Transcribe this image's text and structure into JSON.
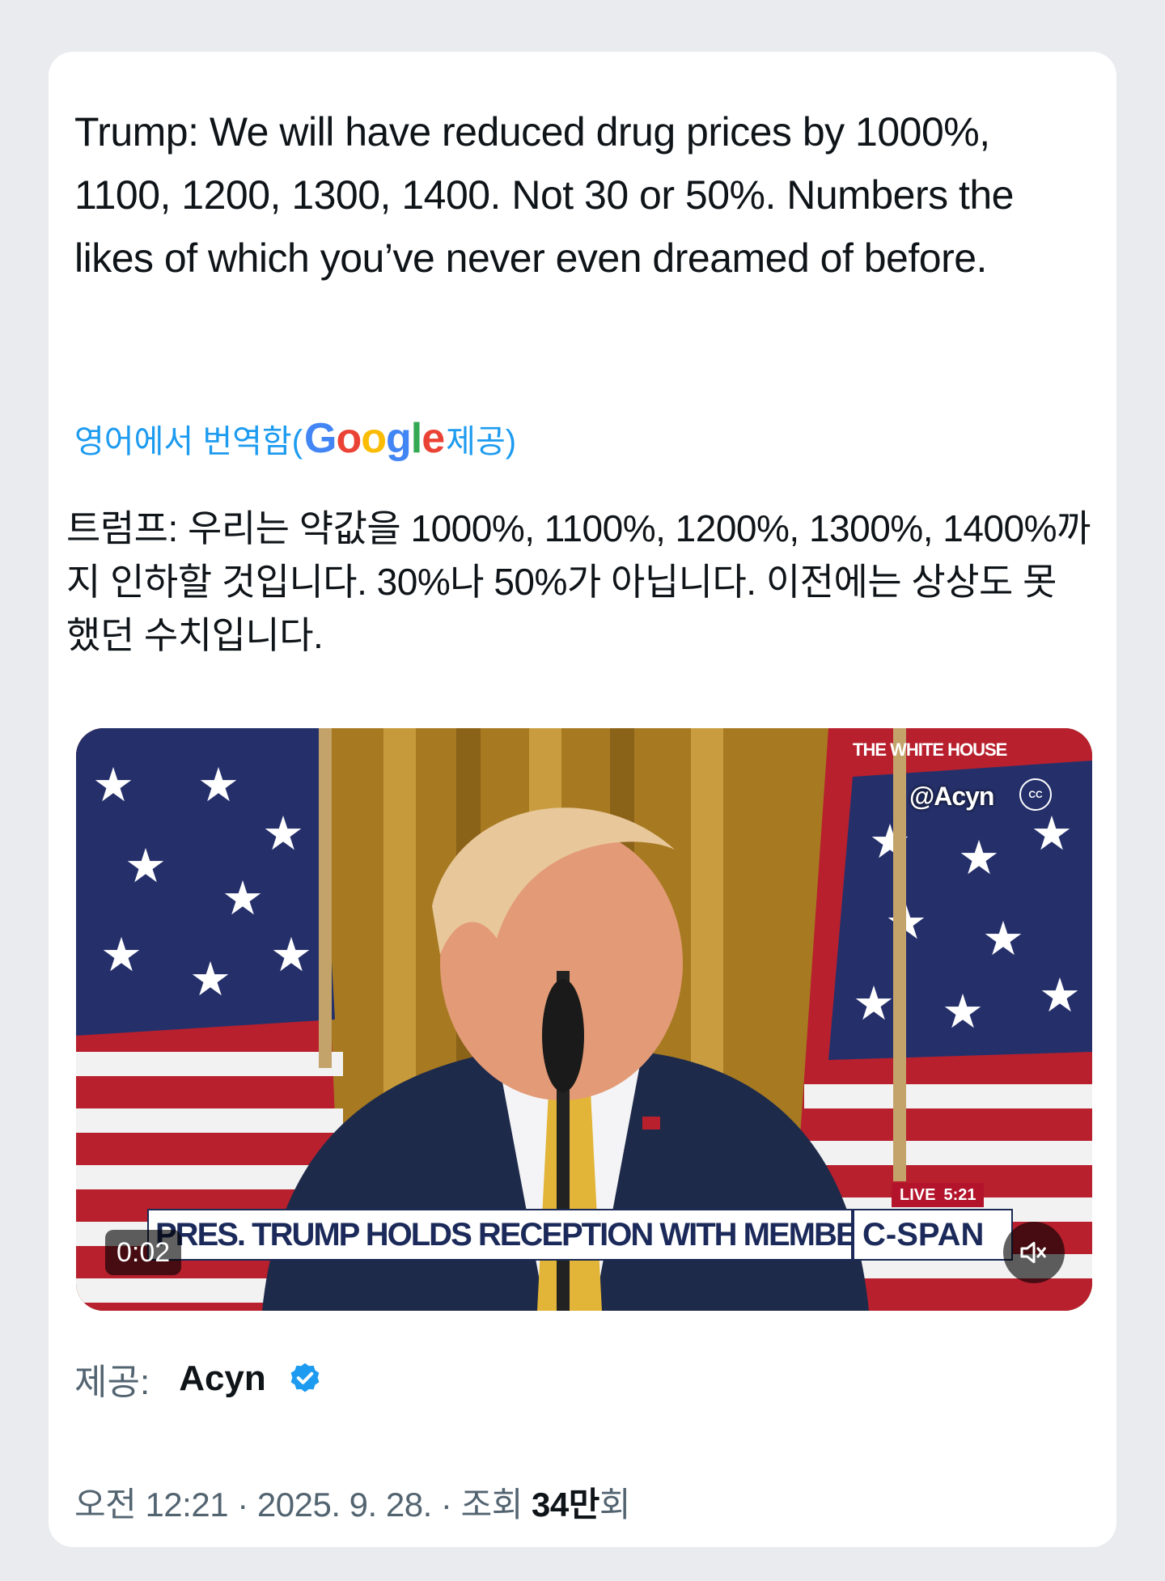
{
  "tweet": {
    "text_en": "Trump: We will have reduced drug prices by 1000%, 1100, 1200, 1300, 1400. Not 30 or 50%. Numbers the likes of which you’ve never even dreamed of before.",
    "translated_prefix": "영어에서 번역함(",
    "google_logo": [
      "G",
      "o",
      "o",
      "g",
      "l",
      "e"
    ],
    "translated_suffix": " 제공)",
    "text_ko": "트럼프: 우리는 약값을 1000%, 1100%, 1200%, 1300%, 1400%까지 인하할 것입니다. 30%나 50%가 아닙니다. 이전에는 상상도 못 했던 수치입니다."
  },
  "video": {
    "overlay_network": "THE WHITE HOUSE",
    "overlay_handle": "@Acyn",
    "cc_label": "CC",
    "live_label": "LIVE",
    "live_time": "5:21",
    "headline": "PRES. TRUMP HOLDS RECEPTION WITH MEMBERS OF CONGRESS",
    "channel": "C-SPAN",
    "timestamp": "0:02",
    "mute_icon": "speaker-muted-icon"
  },
  "source": {
    "label": "제공:",
    "name": "Acyn",
    "verified_icon": "verified-badge-icon",
    "verified_color": "#1d9bf0"
  },
  "meta": {
    "time": "오전 12:21",
    "sep1": " · ",
    "date": "2025. 9. 28.",
    "sep2": " · ",
    "views_label": "조회 ",
    "views_count": "34만",
    "views_suffix": "회"
  }
}
